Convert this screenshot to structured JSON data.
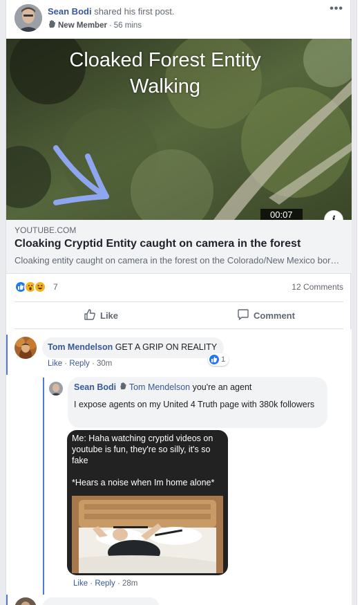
{
  "post": {
    "author": "Sean Bodi",
    "action_text": "shared his first post.",
    "badge": "New Member",
    "separator": "·",
    "time": "56 mins",
    "more_label": "•••"
  },
  "video": {
    "title_line1": "Cloaked Forest Entity",
    "title_line2": "Walking",
    "duration": "00:07",
    "info_label": "i"
  },
  "link_preview": {
    "domain": "YOUTUBE.COM",
    "title": "Cloaking Cryptid Entity caught on camera in the forest",
    "description": "Cloaking entity caught on camera in the forest on the Colorado/New Mexico border"
  },
  "reactions": {
    "count": "7",
    "comments": "12 Comments",
    "types": [
      "like",
      "wow",
      "haha"
    ]
  },
  "actions": {
    "like": "Like",
    "comment": "Comment"
  },
  "comments": [
    {
      "author": "Tom Mendelson",
      "text": "GET A GRIP ON REALITY",
      "like": "Like",
      "reply": "Reply",
      "time": "30m",
      "reaction_count": "1"
    },
    {
      "author": "Sean Bodi",
      "tag": "Tom Mendelson",
      "text_line1": "you're an agent",
      "text_line2": "I expose agents on my United 4 Truth page with 380k followers",
      "meme_text": "Me: Haha watching cryptid videos on youtube is fun, they're so silly, it's so fake\n\n*Hears a noise when Im home alone*",
      "like": "Like",
      "reply": "Reply",
      "time": "28m"
    }
  ],
  "colors": {
    "link_blue": "#385898",
    "like_blue": "#2078f4",
    "reaction_yellow": "#f7b125",
    "thread_line": "#4b7ad6"
  }
}
